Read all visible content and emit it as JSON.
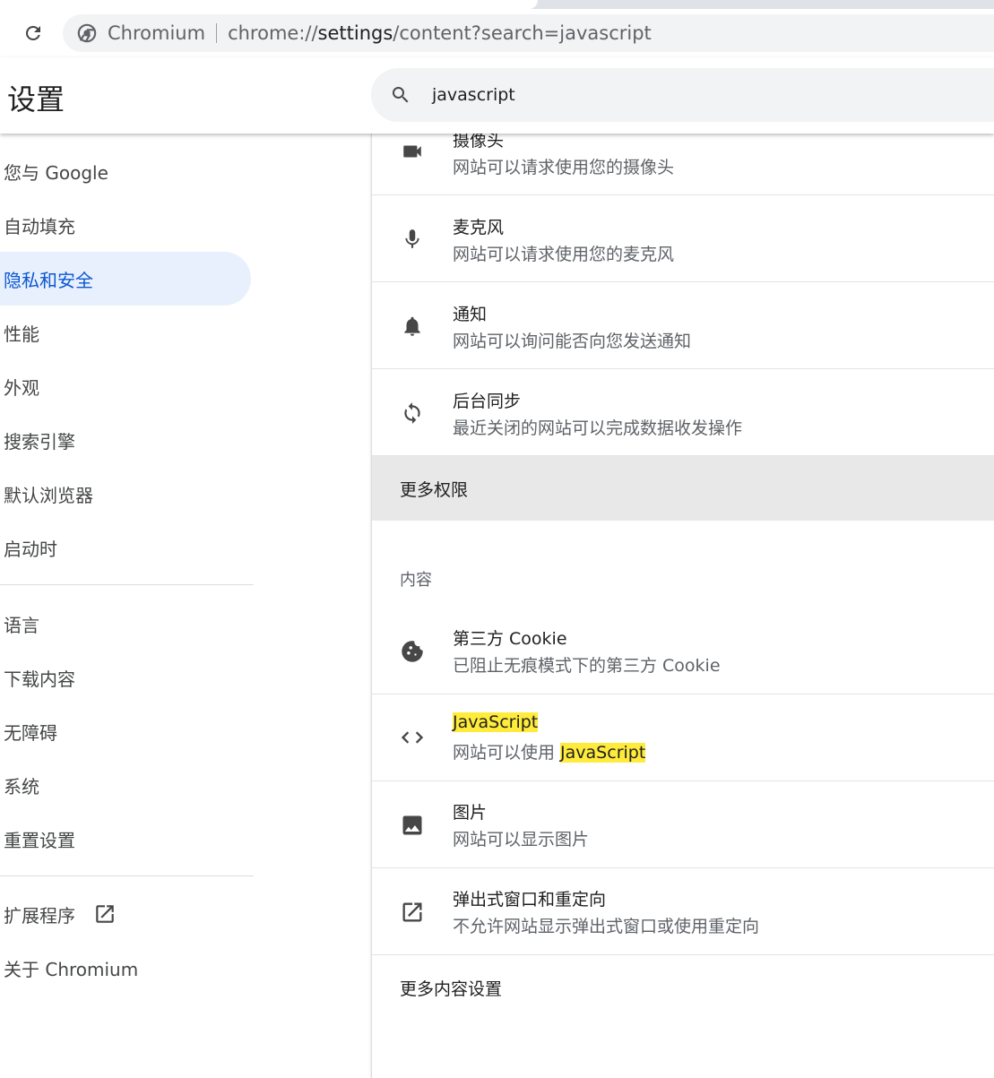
{
  "browser": {
    "origin_label": "Chromium",
    "url_prefix": "chrome://",
    "url_host": "settings",
    "url_path": "/content?search=javascript"
  },
  "header": {
    "title": "设置",
    "search_value": "javascript"
  },
  "sidebar": {
    "items": [
      {
        "label": "您与 Google"
      },
      {
        "label": "自动填充"
      },
      {
        "label": "隐私和安全"
      },
      {
        "label": "性能"
      },
      {
        "label": "外观"
      },
      {
        "label": "搜索引擎"
      },
      {
        "label": "默认浏览器"
      },
      {
        "label": "启动时"
      },
      {
        "label": "语言"
      },
      {
        "label": "下载内容"
      },
      {
        "label": "无障碍"
      },
      {
        "label": "系统"
      },
      {
        "label": "重置设置"
      },
      {
        "label": "扩展程序"
      },
      {
        "label": "关于 Chromium"
      }
    ],
    "active_item": "隐私和安全"
  },
  "main": {
    "permissions": [
      {
        "label": "摄像头",
        "sub": "网站可以请求使用您的摄像头",
        "icon": "videocam-icon"
      },
      {
        "label": "麦克风",
        "sub": "网站可以请求使用您的麦克风",
        "icon": "mic-icon"
      },
      {
        "label": "通知",
        "sub": "网站可以询问能否向您发送通知",
        "icon": "bell-icon"
      },
      {
        "label": "后台同步",
        "sub": "最近关闭的网站可以完成数据收发操作",
        "icon": "sync-icon"
      }
    ],
    "more_permissions": "更多权限",
    "content_heading": "内容",
    "content": [
      {
        "label": "第三方 Cookie",
        "sub": "已阻止无痕模式下的第三方 Cookie",
        "icon": "cookie-icon"
      },
      {
        "label": "JavaScript",
        "sub_prefix": "网站可以使用 ",
        "sub_highlight": "JavaScript",
        "icon": "code-icon"
      },
      {
        "label": "图片",
        "sub": "网站可以显示图片",
        "icon": "image-icon"
      },
      {
        "label": "弹出式窗口和重定向",
        "sub": "不允许网站显示弹出式窗口或使用重定向",
        "icon": "open-in-new-icon"
      }
    ],
    "more_content_settings": "更多内容设置"
  },
  "colors": {
    "accent": "#0b57d0",
    "active_bg": "#e8f0fe",
    "highlight": "#ffeb3b",
    "icon": "#474747"
  }
}
